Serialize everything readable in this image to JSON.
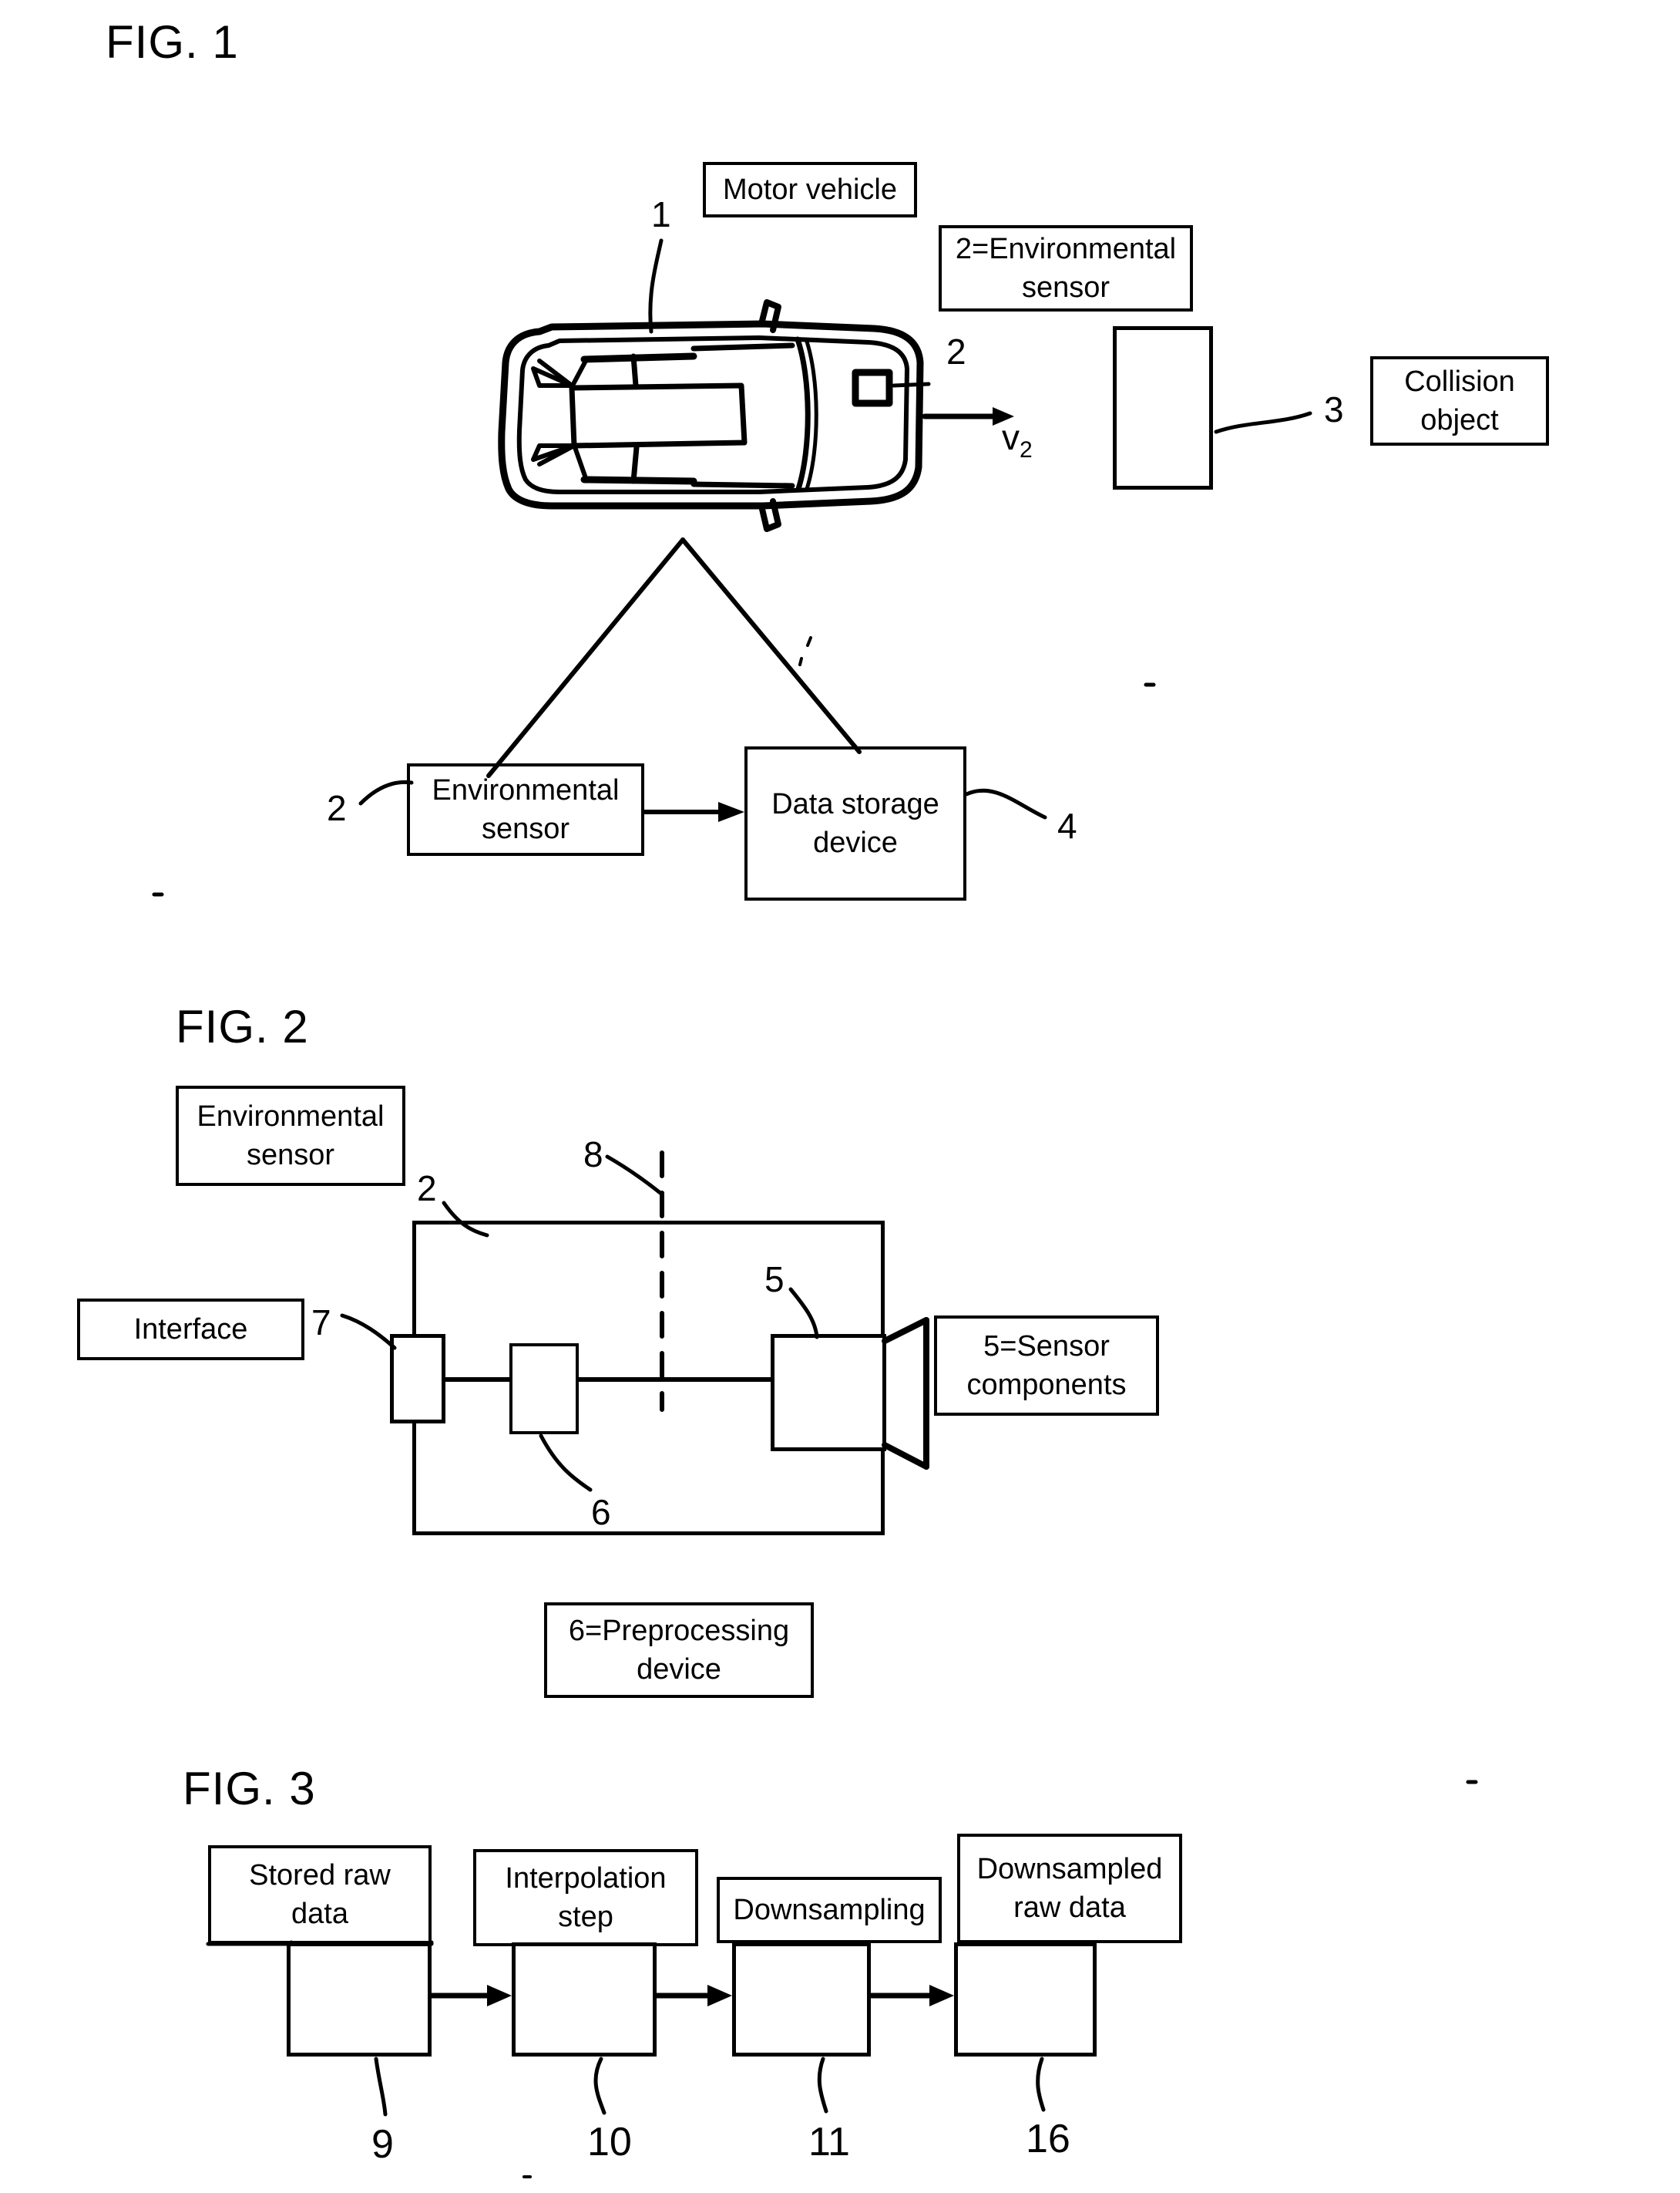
{
  "figures": [
    {
      "id": "fig1",
      "title": "FIG. 1"
    },
    {
      "id": "fig2",
      "title": "FIG. 2"
    },
    {
      "id": "fig3",
      "title": "FIG. 3"
    }
  ],
  "fig1": {
    "title": "FIG. 1",
    "labels": {
      "motor_vehicle": "Motor vehicle",
      "environmental_sensor_eq": "2=Environmental sensor",
      "collision_object": "Collision object",
      "environmental_sensor": "Environmental sensor",
      "data_storage_device": "Data storage device"
    },
    "reference_numbers": {
      "vehicle": "1",
      "sensor_on_vehicle": "2",
      "collision_object": "3",
      "sensor_block": "2",
      "storage_block": "4"
    },
    "velocity_label": "v",
    "velocity_subscript": "2"
  },
  "fig2": {
    "title": "FIG. 2",
    "labels": {
      "environmental_sensor": "Environmental sensor",
      "interface": "Interface",
      "sensor_components_eq": "5=Sensor components",
      "preprocessing_device_eq": "6=Preprocessing device"
    },
    "reference_numbers": {
      "environmental_sensor": "2",
      "dashed_boundary": "8",
      "interface": "7",
      "preprocessing": "6",
      "sensor_components": "5"
    }
  },
  "fig3": {
    "title": "FIG. 3",
    "steps": [
      {
        "label": "Stored raw data",
        "ref": "9"
      },
      {
        "label": "Interpolation step",
        "ref": "10"
      },
      {
        "label": "Downsampling",
        "ref": "11"
      },
      {
        "label": "Downsampled raw data",
        "ref": "16"
      }
    ]
  },
  "colors": {
    "ink": "#000000",
    "paper": "#ffffff"
  }
}
